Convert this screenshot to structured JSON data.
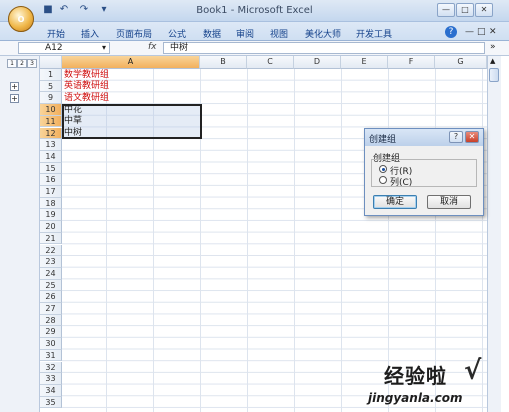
{
  "window": {
    "title": "Book1 - Microsoft Excel",
    "office_button_label": "Office",
    "controls": [
      "—",
      "□",
      "✕"
    ]
  },
  "quick_access": {
    "save": "■",
    "undo": "↶",
    "redo": "↷",
    "customize": "▾"
  },
  "ribbon": {
    "tabs": [
      "开始",
      "插入",
      "页面布局",
      "公式",
      "数据",
      "审阅",
      "视图",
      "美化大师",
      "开发工具"
    ],
    "help": "?",
    "right_controls": [
      "—",
      "□",
      "✕"
    ]
  },
  "formula_bar": {
    "name_box": "A12",
    "fx_label": "fx",
    "value": "中树"
  },
  "outline": {
    "levels": [
      "1",
      "2",
      "3"
    ],
    "expand": "+"
  },
  "columns": [
    "A",
    "B",
    "C",
    "D",
    "E",
    "F",
    "G"
  ],
  "rows": [
    "1",
    "5",
    "9",
    "10",
    "11",
    "12",
    "13",
    "14",
    "15",
    "16",
    "17",
    "18",
    "19",
    "20",
    "21",
    "22",
    "23",
    "24",
    "25",
    "26",
    "27",
    "28",
    "29",
    "30",
    "31",
    "32",
    "33",
    "34",
    "35"
  ],
  "cells": [
    {
      "row": "1",
      "value": "数学教研组",
      "color": "#d01010"
    },
    {
      "row": "5",
      "value": "英语教研组",
      "color": "#d01010"
    },
    {
      "row": "9",
      "value": "语文教研组",
      "color": "#d01010"
    },
    {
      "row": "10",
      "value": "中花",
      "color": "#1e1e1e"
    },
    {
      "row": "11",
      "value": "中草",
      "color": "#1e1e1e"
    },
    {
      "row": "12",
      "value": "中树",
      "color": "#1e1e1e"
    }
  ],
  "dialog": {
    "title": "创建组",
    "group_label": "创建组",
    "options": [
      {
        "label": "行(R)",
        "selected": true
      },
      {
        "label": "列(C)",
        "selected": false
      }
    ],
    "ok": "确定",
    "cancel": "取消",
    "help": "?",
    "close": "✕"
  },
  "watermark": {
    "text": "经验啦",
    "check": "√",
    "url": "jingyanla.com"
  }
}
